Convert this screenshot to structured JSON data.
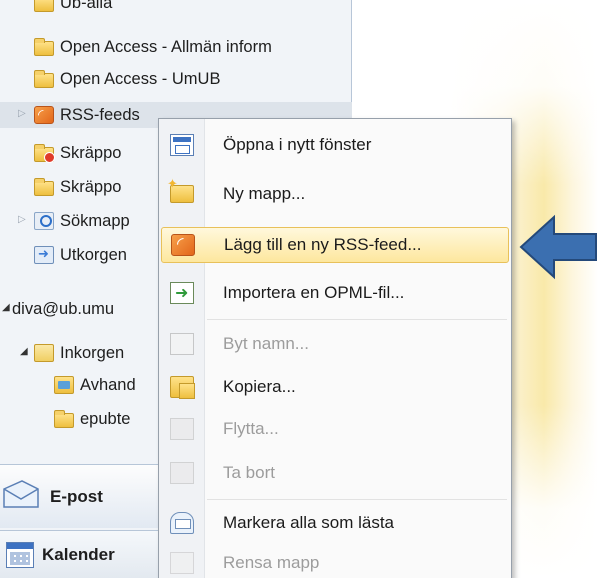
{
  "nav": {
    "items": [
      {
        "label": "Ub-alla",
        "icon": "folder-icon"
      },
      {
        "label": "Open Access - Allmän inform",
        "icon": "folder-icon"
      },
      {
        "label": "Open Access - UmUB",
        "icon": "folder-icon"
      },
      {
        "label": "RSS-feeds",
        "icon": "rss-icon"
      },
      {
        "label": "Skräppo",
        "icon": "junk-folder-icon"
      },
      {
        "label": "Skräppo",
        "icon": "folder-icon"
      },
      {
        "label": "Sökmapp",
        "icon": "search-folder-icon"
      },
      {
        "label": "Utkorgen",
        "icon": "outbox-icon"
      },
      {
        "label": "diva@ub.umu",
        "icon": ""
      },
      {
        "label": "Inkorgen",
        "icon": "inbox-icon"
      },
      {
        "label": "Avhand",
        "icon": "thesis-folder-icon"
      },
      {
        "label": "epubte",
        "icon": "folder-icon"
      }
    ],
    "mail_label": "E-post",
    "calendar_label": "Kalender"
  },
  "context_menu": {
    "items": [
      {
        "label": "Öppna i nytt fönster",
        "icon": "open-window-icon",
        "disabled": false
      },
      {
        "label": "Ny mapp...",
        "icon": "new-folder-icon",
        "disabled": false
      },
      {
        "label": "Lägg till en ny RSS-feed...",
        "icon": "rss-add-icon",
        "disabled": false,
        "highlighted": true
      },
      {
        "label": "Importera en OPML-fil...",
        "icon": "import-icon",
        "disabled": false
      },
      {
        "label": "Byt namn...",
        "icon": "rename-icon",
        "disabled": true
      },
      {
        "label": "Kopiera...",
        "icon": "copy-icon",
        "disabled": false
      },
      {
        "label": "Flytta...",
        "icon": "move-icon",
        "disabled": true
      },
      {
        "label": "Ta bort",
        "icon": "delete-icon",
        "disabled": true
      },
      {
        "label": "Markera alla som lästa",
        "icon": "mark-read-icon",
        "disabled": false
      },
      {
        "label": "Rensa mapp",
        "icon": "clean-folder-icon",
        "disabled": true
      }
    ]
  },
  "annotation": {
    "icon": "blue-arrow-icon",
    "color": "#2f5e9c"
  }
}
